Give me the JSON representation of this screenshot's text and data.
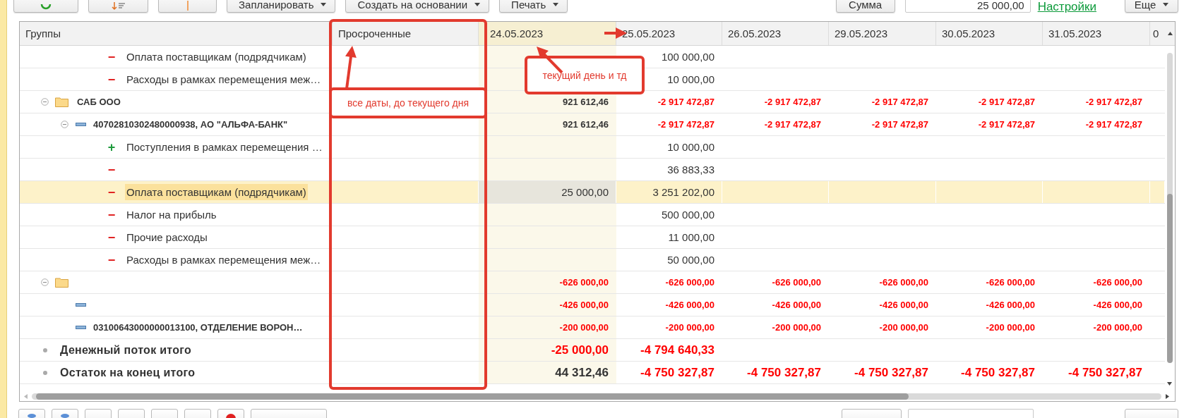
{
  "toolbar": {
    "menus": [
      "Запланировать",
      "Создать на основании",
      "Печать"
    ],
    "sum_button": "Сумма",
    "sum_field": {
      "value": "25 000,00"
    },
    "settings_link": "Настройки",
    "more_menu": "Еще"
  },
  "table": {
    "group_column": "Группы",
    "columns": [
      {
        "label": "Просроченные",
        "highlighted": false
      },
      {
        "label": "24.05.2023",
        "highlighted": true
      },
      {
        "label": "25.05.2023",
        "highlighted": false
      },
      {
        "label": "26.05.2023",
        "highlighted": false
      },
      {
        "label": "29.05.2023",
        "highlighted": false
      },
      {
        "label": "30.05.2023",
        "highlighted": false
      },
      {
        "label": "31.05.2023",
        "highlighted": false
      },
      {
        "label": "0",
        "highlighted": false
      }
    ],
    "rows": [
      {
        "kind": "item",
        "sign": "−",
        "income": false,
        "label": "Оплата поставщикам (подрядчикам)",
        "selected": false,
        "values": [
          {
            "kind": "empty"
          },
          {
            "kind": "empty"
          },
          {
            "kind": "amount",
            "text": "100 000,00",
            "negative": false
          },
          {
            "kind": "empty"
          },
          {
            "kind": "empty"
          },
          {
            "kind": "empty"
          },
          {
            "kind": "empty"
          },
          {
            "kind": "empty"
          }
        ]
      },
      {
        "kind": "item",
        "sign": "−",
        "income": false,
        "label": "Расходы в рамках перемещения меж…",
        "selected": false,
        "values": [
          {
            "kind": "empty"
          },
          {
            "kind": "empty"
          },
          {
            "kind": "amount",
            "text": "10 000,00",
            "negative": false
          },
          {
            "kind": "empty"
          },
          {
            "kind": "empty"
          },
          {
            "kind": "empty"
          },
          {
            "kind": "empty"
          },
          {
            "kind": "empty"
          }
        ]
      },
      {
        "kind": "group",
        "label": "САБ ООО",
        "expanded": true,
        "selected": false,
        "values": [
          {
            "kind": "empty"
          },
          {
            "kind": "amount",
            "text": "921 612,46",
            "negative": false
          },
          {
            "kind": "amount",
            "text": "-2 917 472,87",
            "negative": true
          },
          {
            "kind": "amount",
            "text": "-2 917 472,87",
            "negative": true
          },
          {
            "kind": "amount",
            "text": "-2 917 472,87",
            "negative": true
          },
          {
            "kind": "amount",
            "text": "-2 917 472,87",
            "negative": true
          },
          {
            "kind": "amount",
            "text": "-2 917 472,87",
            "negative": true
          },
          {
            "kind": "empty"
          }
        ],
        "children": [
          {
            "kind": "account",
            "label": "40702810302480000938, АО \"АЛЬФА-БАНК\"",
            "expanded": true,
            "selected": false,
            "values": [
              {
                "kind": "empty"
              },
              {
                "kind": "amount",
                "text": "921 612,46",
                "negative": false
              },
              {
                "kind": "amount",
                "text": "-2 917 472,87",
                "negative": true
              },
              {
                "kind": "amount",
                "text": "-2 917 472,87",
                "negative": true
              },
              {
                "kind": "amount",
                "text": "-2 917 472,87",
                "negative": true
              },
              {
                "kind": "amount",
                "text": "-2 917 472,87",
                "negative": true
              },
              {
                "kind": "amount",
                "text": "-2 917 472,87",
                "negative": true
              },
              {
                "kind": "empty"
              }
            ],
            "children": [
              {
                "kind": "item",
                "sign": "+",
                "income": true,
                "label": "Поступления в рамках перемещения …",
                "selected": false,
                "values": [
                  {
                    "kind": "empty"
                  },
                  {
                    "kind": "empty"
                  },
                  {
                    "kind": "amount",
                    "text": "10 000,00",
                    "negative": false
                  },
                  {
                    "kind": "empty"
                  },
                  {
                    "kind": "empty"
                  },
                  {
                    "kind": "empty"
                  },
                  {
                    "kind": "empty"
                  },
                  {
                    "kind": "empty"
                  }
                ]
              },
              {
                "kind": "item",
                "sign": "−",
                "income": false,
                "selected": false,
                "values": [
                  {
                    "kind": "empty"
                  },
                  {
                    "kind": "empty"
                  },
                  {
                    "kind": "amount",
                    "text": "36 883,33",
                    "negative": false
                  },
                  {
                    "kind": "empty"
                  },
                  {
                    "kind": "empty"
                  },
                  {
                    "kind": "empty"
                  },
                  {
                    "kind": "empty"
                  },
                  {
                    "kind": "empty"
                  }
                ]
              },
              {
                "kind": "item",
                "sign": "−",
                "income": false,
                "label": "Оплата поставщикам (подрядчикам)",
                "selected": true,
                "values": [
                  {
                    "kind": "empty"
                  },
                  {
                    "kind": "focused",
                    "text": "25 000,00",
                    "negative": false
                  },
                  {
                    "kind": "amount",
                    "text": "3 251 202,00",
                    "negative": false
                  },
                  {
                    "kind": "empty"
                  },
                  {
                    "kind": "empty"
                  },
                  {
                    "kind": "empty"
                  },
                  {
                    "kind": "empty"
                  },
                  {
                    "kind": "empty"
                  }
                ]
              },
              {
                "kind": "item",
                "sign": "−",
                "income": false,
                "label": "Налог на прибыль",
                "selected": false,
                "values": [
                  {
                    "kind": "empty"
                  },
                  {
                    "kind": "empty"
                  },
                  {
                    "kind": "amount",
                    "text": "500 000,00",
                    "negative": false
                  },
                  {
                    "kind": "empty"
                  },
                  {
                    "kind": "empty"
                  },
                  {
                    "kind": "empty"
                  },
                  {
                    "kind": "empty"
                  },
                  {
                    "kind": "empty"
                  }
                ]
              },
              {
                "kind": "item",
                "sign": "−",
                "income": false,
                "label": "Прочие расходы",
                "selected": false,
                "values": [
                  {
                    "kind": "empty"
                  },
                  {
                    "kind": "empty"
                  },
                  {
                    "kind": "amount",
                    "text": "11 000,00",
                    "negative": false
                  },
                  {
                    "kind": "empty"
                  },
                  {
                    "kind": "empty"
                  },
                  {
                    "kind": "empty"
                  },
                  {
                    "kind": "empty"
                  },
                  {
                    "kind": "empty"
                  }
                ]
              },
              {
                "kind": "item",
                "sign": "−",
                "income": false,
                "label": "Расходы в рамках перемещения меж…",
                "selected": false,
                "values": [
                  {
                    "kind": "empty"
                  },
                  {
                    "kind": "empty"
                  },
                  {
                    "kind": "amount",
                    "text": "50 000,00",
                    "negative": false
                  },
                  {
                    "kind": "empty"
                  },
                  {
                    "kind": "empty"
                  },
                  {
                    "kind": "empty"
                  },
                  {
                    "kind": "empty"
                  },
                  {
                    "kind": "empty"
                  }
                ]
              }
            ]
          }
        ]
      },
      {
        "kind": "group",
        "expanded": true,
        "selected": false,
        "values": [
          {
            "kind": "empty"
          },
          {
            "kind": "amount",
            "text": "-626 000,00",
            "negative": true
          },
          {
            "kind": "amount",
            "text": "-626 000,00",
            "negative": true
          },
          {
            "kind": "amount",
            "text": "-626 000,00",
            "negative": true
          },
          {
            "kind": "amount",
            "text": "-626 000,00",
            "negative": true
          },
          {
            "kind": "amount",
            "text": "-626 000,00",
            "negative": true
          },
          {
            "kind": "amount",
            "text": "-626 000,00",
            "negative": true
          },
          {
            "kind": "empty"
          }
        ],
        "children": [
          {
            "kind": "account",
            "selected": false,
            "values": [
              {
                "kind": "empty"
              },
              {
                "kind": "amount",
                "text": "-426 000,00",
                "negative": true
              },
              {
                "kind": "amount",
                "text": "-426 000,00",
                "negative": true
              },
              {
                "kind": "amount",
                "text": "-426 000,00",
                "negative": true
              },
              {
                "kind": "amount",
                "text": "-426 000,00",
                "negative": true
              },
              {
                "kind": "amount",
                "text": "-426 000,00",
                "negative": true
              },
              {
                "kind": "amount",
                "text": "-426 000,00",
                "negative": true
              },
              {
                "kind": "empty"
              }
            ]
          },
          {
            "kind": "account",
            "label": "03100643000000013100, ОТДЕЛЕНИЕ ВОРОН…",
            "selected": false,
            "values": [
              {
                "kind": "empty"
              },
              {
                "kind": "amount",
                "text": "-200 000,00",
                "negative": true
              },
              {
                "kind": "amount",
                "text": "-200 000,00",
                "negative": true
              },
              {
                "kind": "amount",
                "text": "-200 000,00",
                "negative": true
              },
              {
                "kind": "amount",
                "text": "-200 000,00",
                "negative": true
              },
              {
                "kind": "amount",
                "text": "-200 000,00",
                "negative": true
              },
              {
                "kind": "amount",
                "text": "-200 000,00",
                "negative": true
              },
              {
                "kind": "empty"
              }
            ]
          }
        ]
      },
      {
        "kind": "total",
        "label": "Денежный поток итого",
        "selected": false,
        "values": [
          {
            "kind": "empty"
          },
          {
            "kind": "amount",
            "text": "-25 000,00",
            "negative": true
          },
          {
            "kind": "amount",
            "text": "-4 794 640,33",
            "negative": true
          },
          {
            "kind": "empty"
          },
          {
            "kind": "empty"
          },
          {
            "kind": "empty"
          },
          {
            "kind": "empty"
          },
          {
            "kind": "empty"
          }
        ]
      },
      {
        "kind": "total",
        "label": "Остаток на конец итого",
        "selected": false,
        "values": [
          {
            "kind": "empty"
          },
          {
            "kind": "amount",
            "text": "44 312,46",
            "negative": false
          },
          {
            "kind": "amount",
            "text": "-4 750 327,87",
            "negative": true
          },
          {
            "kind": "amount",
            "text": "-4 750 327,87",
            "negative": true
          },
          {
            "kind": "amount",
            "text": "-4 750 327,87",
            "negative": true
          },
          {
            "kind": "amount",
            "text": "-4 750 327,87",
            "negative": true
          },
          {
            "kind": "amount",
            "text": "-4 750 327,87",
            "negative": true
          },
          {
            "kind": "empty"
          }
        ]
      }
    ]
  },
  "annotations": [
    {
      "kind": "box"
    },
    {
      "kind": "note",
      "text": "все даты, до текущего дня"
    },
    {
      "kind": "note",
      "text": "текущий день и тд"
    },
    {
      "kind": "arrow"
    },
    {
      "kind": "arrow"
    },
    {
      "kind": "arrow"
    }
  ]
}
